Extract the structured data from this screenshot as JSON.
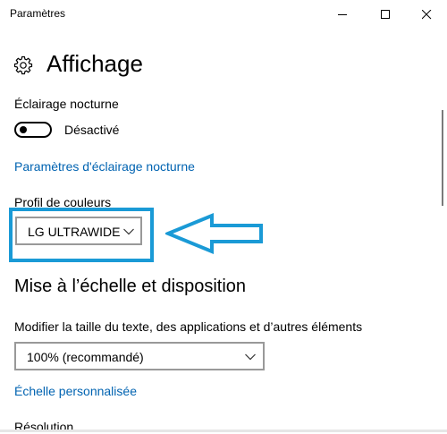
{
  "window": {
    "title": "Paramètres",
    "controls": {
      "minimize": "minimize",
      "maximize": "maximize",
      "close": "close"
    }
  },
  "header": {
    "icon": "gear-icon",
    "title": "Affichage"
  },
  "night_light": {
    "label": "Éclairage nocturne",
    "toggle_state": "Désactivé",
    "toggle_on": false,
    "settings_link": "Paramètres d'éclairage nocturne"
  },
  "color_profile": {
    "label": "Profil de couleurs",
    "selected": "LG ULTRAWIDE",
    "annotation_color": "#1a9ad6"
  },
  "scale_layout": {
    "title": "Mise à l’échelle et disposition",
    "size_label": "Modifier la taille du texte, des applications et d’autres éléments",
    "size_selected": "100% (recommandé)",
    "custom_scaling_link": "Échelle personnalisée",
    "resolution_label": "Résolution"
  },
  "colors": {
    "accent_link": "#0063b1",
    "annotation": "#1a9ad6"
  }
}
